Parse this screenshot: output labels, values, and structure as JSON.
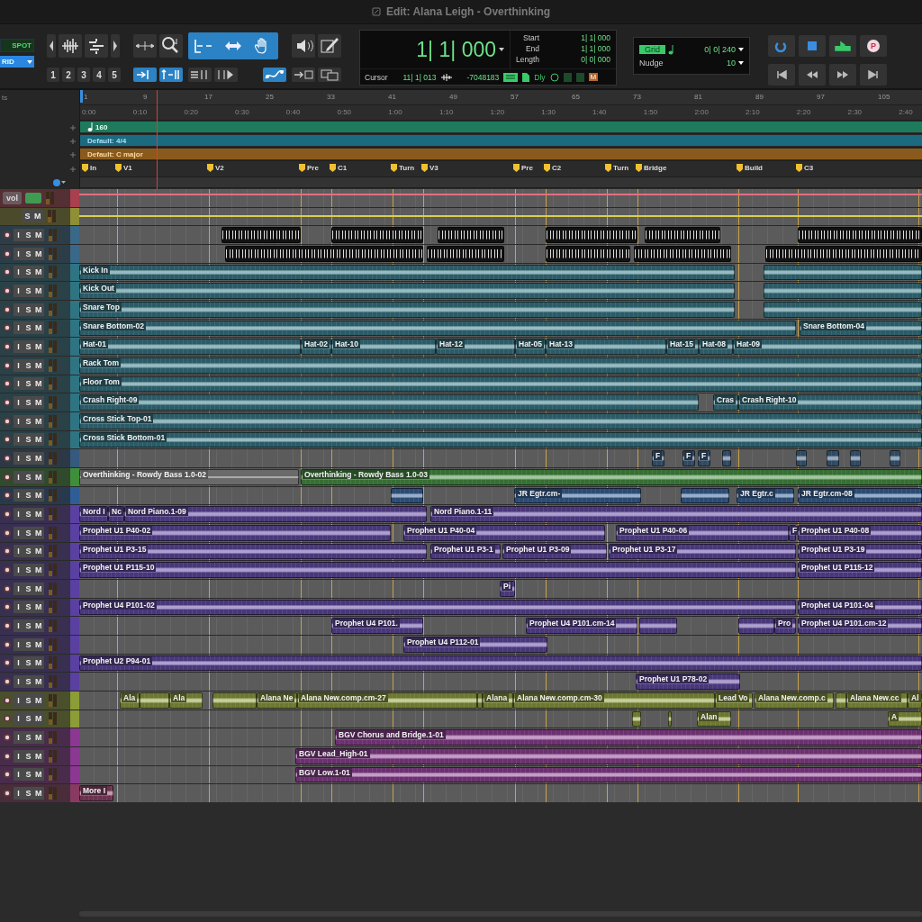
{
  "window": {
    "title": "Edit: Alana Leigh - Overthinking"
  },
  "toolbar": {
    "modes": [
      "SPOT",
      "RID"
    ],
    "tools": [
      {
        "selected": false
      },
      {
        "selected": false
      },
      {
        "selected": false
      },
      {
        "selected": false
      },
      {
        "selected": false
      },
      {
        "selected": false
      },
      {
        "selected": true
      },
      {
        "selected": true
      },
      {
        "selected": true
      },
      {
        "selected": false
      },
      {
        "selected": false
      }
    ],
    "zoom_presets": [
      "1",
      "2",
      "3",
      "4",
      "5"
    ],
    "tools_row2": [
      {
        "selected": true
      },
      {
        "selected": true
      },
      {
        "selected": false
      },
      {
        "selected": false
      },
      {
        "selected": true
      },
      {
        "selected": false
      },
      {
        "selected": false
      }
    ]
  },
  "counter": {
    "main": "1| 1| 000",
    "fields": [
      {
        "label": "Start",
        "value": "1| 1| 000"
      },
      {
        "label": "End",
        "value": "1| 1| 000"
      },
      {
        "label": "Length",
        "value": "0| 0| 000"
      }
    ],
    "cursor_label": "Cursor",
    "cursor_value": "11| 1| 013",
    "sample_value": "-7048183",
    "delay": "Dly",
    "m_button": "M"
  },
  "grid": {
    "label": "Grid",
    "value": "0| 0| 240",
    "nudge_label": "Nudge",
    "nudge_value": "10"
  },
  "transport": {
    "record_label": "P"
  },
  "rulers": {
    "header": "ts",
    "bars": [
      "1",
      "9",
      "17",
      "25",
      "33",
      "41",
      "49",
      "57",
      "65",
      "73",
      "81",
      "89",
      "97",
      "105"
    ],
    "times": [
      "0:00",
      "0:10",
      "0:20",
      "0:30",
      "0:40",
      "0:50",
      "1:00",
      "1:10",
      "1:20",
      "1:30",
      "1:40",
      "1:50",
      "2:00",
      "2:10",
      "2:20",
      "2:30",
      "2:40"
    ],
    "tempo": "160",
    "meter": "Default: 4/4",
    "key": "Default: C major",
    "markers": [
      {
        "name": "In"
      },
      {
        "name": "V1"
      },
      {
        "name": "V2"
      },
      {
        "name": "Pre"
      },
      {
        "name": "C1"
      },
      {
        "name": "Turn"
      },
      {
        "name": "V3"
      },
      {
        "name": "Pre"
      },
      {
        "name": "C2"
      },
      {
        "name": "Turn"
      },
      {
        "name": "Bridge"
      },
      {
        "name": "Build"
      },
      {
        "name": "C3"
      }
    ]
  },
  "tracks": [
    {
      "kind": "automation",
      "color": "#a8404e",
      "buttons": [
        "vol"
      ]
    },
    {
      "kind": "vca",
      "color": "#8f8f36",
      "buttons": [
        "S",
        "M"
      ]
    },
    {
      "kind": "midi",
      "color": "#3a6888",
      "buttons": [
        "I",
        "S",
        "M"
      ],
      "clips": [
        {
          "muted": false
        },
        {
          "muted": false
        },
        {
          "muted": false
        },
        {
          "muted": false
        },
        {
          "muted": false
        },
        {
          "muted": false
        }
      ]
    },
    {
      "kind": "midi",
      "color": "#3a6888",
      "buttons": [
        "I",
        "S",
        "M"
      ],
      "clips": [
        {
          "muted": false
        },
        {
          "muted": false
        },
        {
          "muted": false
        },
        {
          "muted": false
        },
        {
          "muted": false
        }
      ]
    },
    {
      "kind": "audio",
      "color": "#2f7483",
      "buttons": [
        "I",
        "S",
        "M"
      ],
      "clips": [
        {
          "name": "Kick In",
          "muted": false
        },
        {
          "muted": false
        }
      ]
    },
    {
      "kind": "audio",
      "color": "#2f7483",
      "buttons": [
        "I",
        "S",
        "M"
      ],
      "clips": [
        {
          "name": "Kick Out",
          "muted": false
        },
        {
          "muted": false
        }
      ]
    },
    {
      "kind": "audio",
      "color": "#2f7483",
      "buttons": [
        "I",
        "S",
        "M"
      ],
      "clips": [
        {
          "name": "Snare Top",
          "muted": false
        },
        {
          "muted": false
        }
      ]
    },
    {
      "kind": "audio",
      "color": "#2f7483",
      "buttons": [
        "I",
        "S",
        "M"
      ],
      "clips": [
        {
          "name": "Snare Bottom-02",
          "muted": false
        },
        {
          "name": "Snare Bottom-04",
          "muted": false
        }
      ]
    },
    {
      "kind": "audio",
      "color": "#2f7483",
      "buttons": [
        "I",
        "S",
        "M"
      ],
      "clips": [
        {
          "name": "Hat-01",
          "muted": false
        },
        {
          "name": "Hat-02",
          "muted": false
        },
        {
          "name": "Hat-10",
          "muted": false
        },
        {
          "name": "Hat-12",
          "muted": false
        },
        {
          "name": "Hat-05",
          "muted": false
        },
        {
          "name": "Hat-13",
          "muted": false
        },
        {
          "name": "Hat-15",
          "muted": false
        },
        {
          "name": "Hat-08",
          "muted": false
        },
        {
          "name": "Hat-09",
          "muted": false
        }
      ]
    },
    {
      "kind": "audio",
      "color": "#2f7483",
      "buttons": [
        "I",
        "S",
        "M"
      ],
      "clips": [
        {
          "name": "Rack Tom",
          "muted": false
        }
      ]
    },
    {
      "kind": "audio",
      "color": "#2f7483",
      "buttons": [
        "I",
        "S",
        "M"
      ],
      "clips": [
        {
          "name": "Floor Tom",
          "muted": false
        }
      ]
    },
    {
      "kind": "audio",
      "color": "#2f7483",
      "buttons": [
        "I",
        "S",
        "M"
      ],
      "clips": [
        {
          "name": "Crash Right-09",
          "muted": false
        },
        {
          "name": "Cras",
          "muted": false
        },
        {
          "name": "Crash Right-10",
          "muted": false
        }
      ]
    },
    {
      "kind": "audio",
      "color": "#2f7483",
      "buttons": [
        "I",
        "S",
        "M"
      ],
      "clips": [
        {
          "name": "Cross Stick Top-01",
          "muted": false
        }
      ]
    },
    {
      "kind": "audio",
      "color": "#2f7483",
      "buttons": [
        "I",
        "S",
        "M"
      ],
      "clips": [
        {
          "name": "Cross Stick Bottom-01",
          "muted": false
        }
      ]
    },
    {
      "kind": "audio",
      "color": "#36597e",
      "buttons": [
        "I",
        "S",
        "M"
      ],
      "clips": [
        {
          "name": "F",
          "muted": false
        },
        {
          "name": "F",
          "muted": false
        },
        {
          "name": "F",
          "muted": false
        },
        {
          "muted": false
        },
        {
          "muted": false
        },
        {
          "muted": false
        },
        {
          "muted": false
        },
        {
          "muted": false
        }
      ]
    },
    {
      "kind": "audio",
      "color": "#3f8e3a",
      "buttons": [
        "I",
        "S",
        "M"
      ],
      "clips": [
        {
          "name": "Overthinking - Rowdy Bass 1.0-02",
          "muted": true
        },
        {
          "name": "Overthinking - Rowdy Bass 1.0-03",
          "muted": false
        }
      ]
    },
    {
      "kind": "audio",
      "color": "#2f5d96",
      "buttons": [
        "I",
        "S",
        "M"
      ],
      "clips": [
        {
          "muted": false
        },
        {
          "name": "JR Egtr.cm-",
          "muted": false
        },
        {
          "muted": false
        },
        {
          "name": "JR Egtr.c",
          "muted": false
        },
        {
          "name": "JR Egtr.cm-08",
          "muted": false
        }
      ]
    },
    {
      "kind": "audio",
      "color": "#5a40a0",
      "buttons": [
        "I",
        "S",
        "M"
      ],
      "clips": [
        {
          "name": "Nord I",
          "muted": false
        },
        {
          "name": "Nc",
          "muted": false
        },
        {
          "name": "Nord Piano.1-09",
          "muted": false
        },
        {
          "name": "Nord Piano.1-11",
          "muted": false
        }
      ]
    },
    {
      "kind": "audio",
      "color": "#5a40a0",
      "buttons": [
        "I",
        "S",
        "M"
      ],
      "clips": [
        {
          "name": "Prophet U1 P40-02",
          "muted": false
        },
        {
          "name": "Prophet U1 P40-04",
          "muted": false
        },
        {
          "name": "Prophet U1 P40-06",
          "muted": false
        },
        {
          "name": "F",
          "muted": false
        },
        {
          "name": "Prophet U1 P40-08",
          "muted": false
        }
      ]
    },
    {
      "kind": "audio",
      "color": "#5a40a0",
      "buttons": [
        "I",
        "S",
        "M"
      ],
      "clips": [
        {
          "name": "Prophet U1 P3-15",
          "muted": false
        },
        {
          "name": "Prophet U1 P3-1",
          "muted": false
        },
        {
          "name": "Prophet U1 P3-09",
          "muted": false
        },
        {
          "name": "Prophet U1 P3-17",
          "muted": false
        },
        {
          "name": "Prophet U1 P3-19",
          "muted": false
        }
      ]
    },
    {
      "kind": "audio",
      "color": "#5a40a0",
      "buttons": [
        "I",
        "S",
        "M"
      ],
      "clips": [
        {
          "name": "Prophet U1 P115-10",
          "muted": false
        },
        {
          "name": "Prophet U1 P115-12",
          "muted": false
        }
      ]
    },
    {
      "kind": "audio",
      "color": "#5a40a0",
      "buttons": [
        "I",
        "S",
        "M"
      ],
      "clips": [
        {
          "name": "Pi",
          "muted": false
        }
      ]
    },
    {
      "kind": "audio",
      "color": "#5a40a0",
      "buttons": [
        "I",
        "S",
        "M"
      ],
      "clips": [
        {
          "name": "Prophet U4 P101-02",
          "muted": false
        },
        {
          "name": "Prophet U4 P101-04",
          "muted": false
        }
      ]
    },
    {
      "kind": "audio",
      "color": "#5a40a0",
      "buttons": [
        "I",
        "S",
        "M"
      ],
      "clips": [
        {
          "name": "Prophet U4 P101.",
          "muted": false
        },
        {
          "name": "Prophet U4 P101.cm-14",
          "muted": false
        },
        {
          "muted": false
        },
        {
          "muted": false
        },
        {
          "name": "Pro",
          "muted": false
        },
        {
          "name": "Prophet U4 P101.cm-12",
          "muted": false
        }
      ]
    },
    {
      "kind": "audio",
      "color": "#5a40a0",
      "buttons": [
        "I",
        "S",
        "M"
      ],
      "clips": [
        {
          "name": "Prophet U4 P112-01",
          "muted": false
        }
      ]
    },
    {
      "kind": "audio",
      "color": "#5a40a0",
      "buttons": [
        "I",
        "S",
        "M"
      ],
      "clips": [
        {
          "name": "Prophet U2 P94-01",
          "muted": false
        }
      ]
    },
    {
      "kind": "audio",
      "color": "#5a40a0",
      "buttons": [
        "I",
        "S",
        "M"
      ],
      "clips": [
        {
          "name": "Prophet U1 P78-02",
          "muted": false
        }
      ]
    },
    {
      "kind": "audio",
      "color": "#8c9c36",
      "buttons": [
        "I",
        "S",
        "M"
      ],
      "clips": [
        {
          "name": "Ala",
          "muted": false
        },
        {
          "muted": false
        },
        {
          "name": "Ala",
          "muted": false
        },
        {
          "muted": false
        },
        {
          "name": "Alana Ne",
          "muted": false
        },
        {
          "name": "Alana New.comp.cm-27",
          "muted": false
        },
        {
          "muted": false
        },
        {
          "name": "Alana",
          "muted": false
        },
        {
          "name": "Alana New.comp.cm-30",
          "muted": false
        },
        {
          "name": "Lead Vo",
          "muted": false
        },
        {
          "name": "Alana New.comp.c",
          "muted": false
        },
        {
          "muted": false
        },
        {
          "name": "Alana New.cc",
          "muted": false
        },
        {
          "name": "Al",
          "muted": false
        }
      ]
    },
    {
      "kind": "audio",
      "color": "#8c9c36",
      "buttons": [
        "I",
        "S",
        "M"
      ],
      "clips": [
        {
          "muted": false
        },
        {
          "muted": false
        },
        {
          "name": "Alan",
          "muted": false
        },
        {
          "name": "A",
          "muted": false
        }
      ]
    },
    {
      "kind": "audio",
      "color": "#8a3890",
      "buttons": [
        "I",
        "S",
        "M"
      ],
      "clips": [
        {
          "name": "BGV Chorus and Bridge.1-01",
          "muted": false
        }
      ]
    },
    {
      "kind": "audio",
      "color": "#8a3890",
      "buttons": [
        "I",
        "S",
        "M"
      ],
      "clips": [
        {
          "name": "BGV Lead_High-01",
          "muted": false
        }
      ]
    },
    {
      "kind": "audio",
      "color": "#8a3890",
      "buttons": [
        "I",
        "S",
        "M"
      ],
      "clips": [
        {
          "name": "BGV Low.1-01",
          "muted": false
        }
      ]
    },
    {
      "kind": "audio",
      "color": "#8a3a62",
      "buttons": [
        "I",
        "S",
        "M"
      ],
      "clips": [
        {
          "name": "More I",
          "muted": false
        }
      ]
    }
  ]
}
